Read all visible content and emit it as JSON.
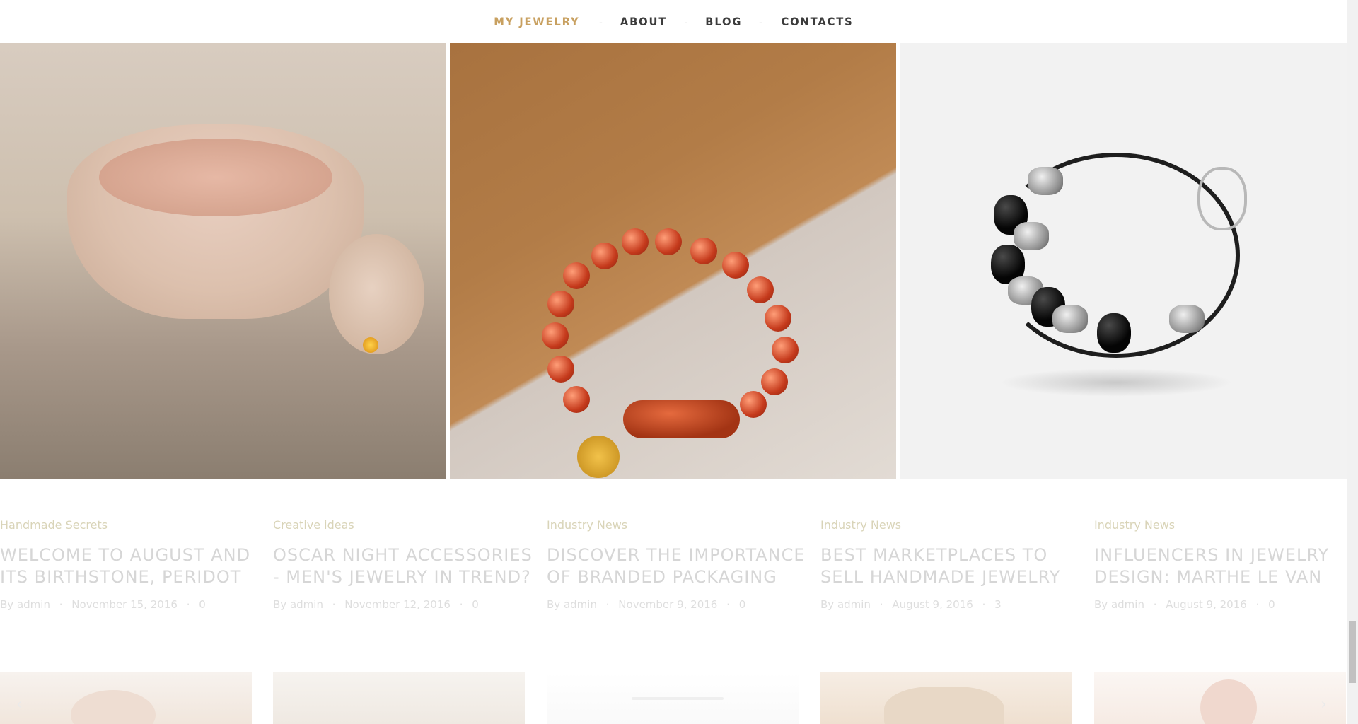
{
  "nav": {
    "items": [
      {
        "label": "MY JEWELRY",
        "active": true
      },
      {
        "label": "ABOUT",
        "active": false
      },
      {
        "label": "BLOG",
        "active": false
      },
      {
        "label": "CONTACTS",
        "active": false
      }
    ],
    "separator": "-",
    "active_color": "#c8a060"
  },
  "hero": {
    "images": [
      {
        "subject": "cuff-bracelet-and-ring"
      },
      {
        "subject": "carnelian-bead-bracelet"
      },
      {
        "subject": "black-and-silver-bead-bracelet"
      }
    ]
  },
  "posts": [
    {
      "category": "Handmade Secrets",
      "title": "WELCOME TO AUGUST AND ITS BIRTHSTONE, PERIDOT",
      "by": "By",
      "author": "admin",
      "date": "November 15, 2016",
      "comments": "0"
    },
    {
      "category": "Creative ideas",
      "title": "OSCAR NIGHT ACCESSORIES - MEN'S JEWELRY IN TREND?",
      "by": "By",
      "author": "admin",
      "date": "November 12, 2016",
      "comments": "0"
    },
    {
      "category": "Industry News",
      "title": "DISCOVER THE IMPORTANCE OF BRANDED PACKAGING",
      "by": "By",
      "author": "admin",
      "date": "November 9, 2016",
      "comments": "0"
    },
    {
      "category": "Industry News",
      "title": "BEST MARKETPLACES TO SELL HANDMADE JEWELRY",
      "by": "By",
      "author": "admin",
      "date": "August 9, 2016",
      "comments": "3"
    },
    {
      "category": "Industry News",
      "title": "INFLUENCERS IN JEWELRY DESIGN: MARTHE LE VAN",
      "by": "By",
      "author": "admin",
      "date": "August 9, 2016",
      "comments": "0"
    }
  ],
  "carousel": {
    "prev_icon": "chevron-left-icon",
    "next_icon": "chevron-right-icon",
    "prev_glyph": "‹",
    "next_glyph": "›"
  }
}
